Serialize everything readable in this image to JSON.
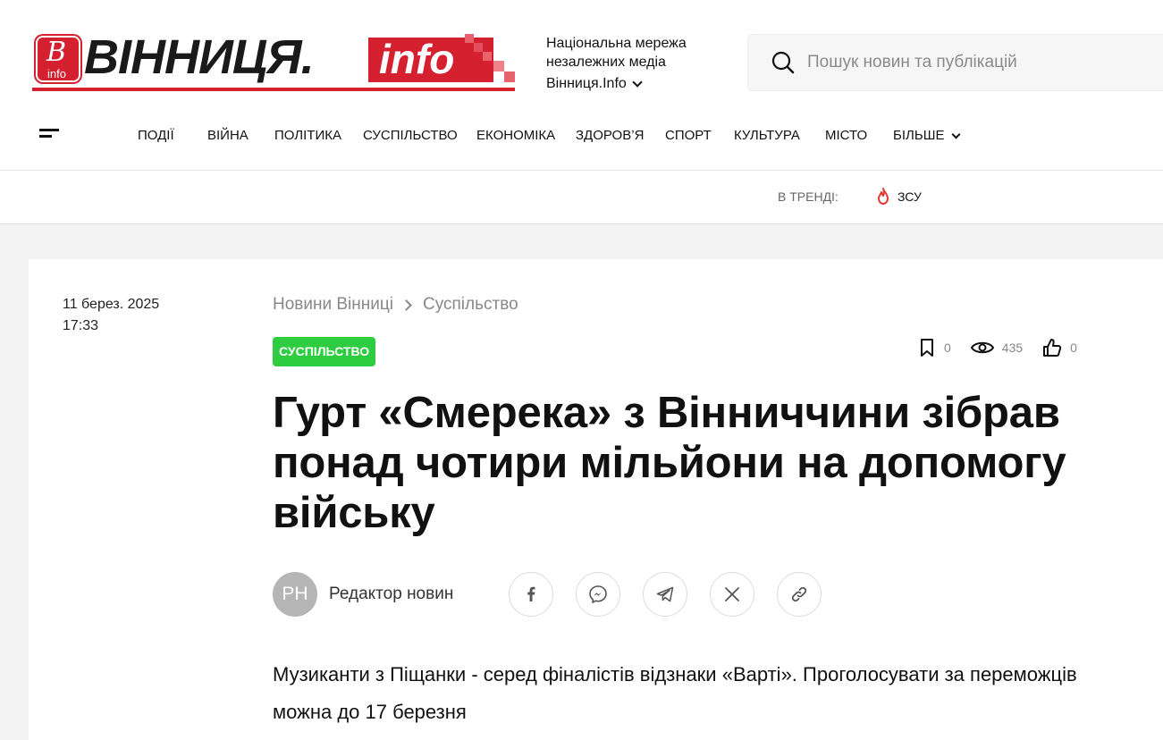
{
  "brand": {
    "logo_badge_letter": "B",
    "logo_badge_sub": "info",
    "logo_main": "ВІННИЦЯ.",
    "logo_info": "info",
    "tagline_line1": "Національна мережа",
    "tagline_line2": "незалежних медіа",
    "network_selector": "Вінниця.Info",
    "colors": {
      "brand_red": "#d4202f",
      "tag_green": "#2ecc40"
    }
  },
  "search": {
    "placeholder": "Пошук новин та публікацій",
    "value": ""
  },
  "nav": {
    "items": [
      "Події",
      "Війна",
      "Політика",
      "Суспільство",
      "Економіка",
      "Здоров’я",
      "Спорт",
      "Культура",
      "Місто"
    ],
    "more_label": "Більше"
  },
  "trending": {
    "label": "В ТРЕНДІ:",
    "items": [
      "ЗСУ"
    ]
  },
  "article": {
    "date": "11 берез. 2025",
    "time": "17:33",
    "breadcrumb": [
      "Новини Вінниці",
      "Суспільство"
    ],
    "category_tag": "СУСПІЛЬСТВО",
    "bookmarks": "0",
    "views": "435",
    "likes": "0",
    "title": "Гурт «Смерека» з Вінниччини зібрав понад чотири мільйони на допомогу війську",
    "author_initials": "РН",
    "author_name": "Редактор новин",
    "share_icons": [
      "facebook-icon",
      "messenger-icon",
      "telegram-icon",
      "x-icon",
      "link-icon"
    ],
    "lead": "Музиканти з Піщанки - серед фіналістів відзнаки «Варті». Проголосувати за переможців можна до 17 березня"
  }
}
